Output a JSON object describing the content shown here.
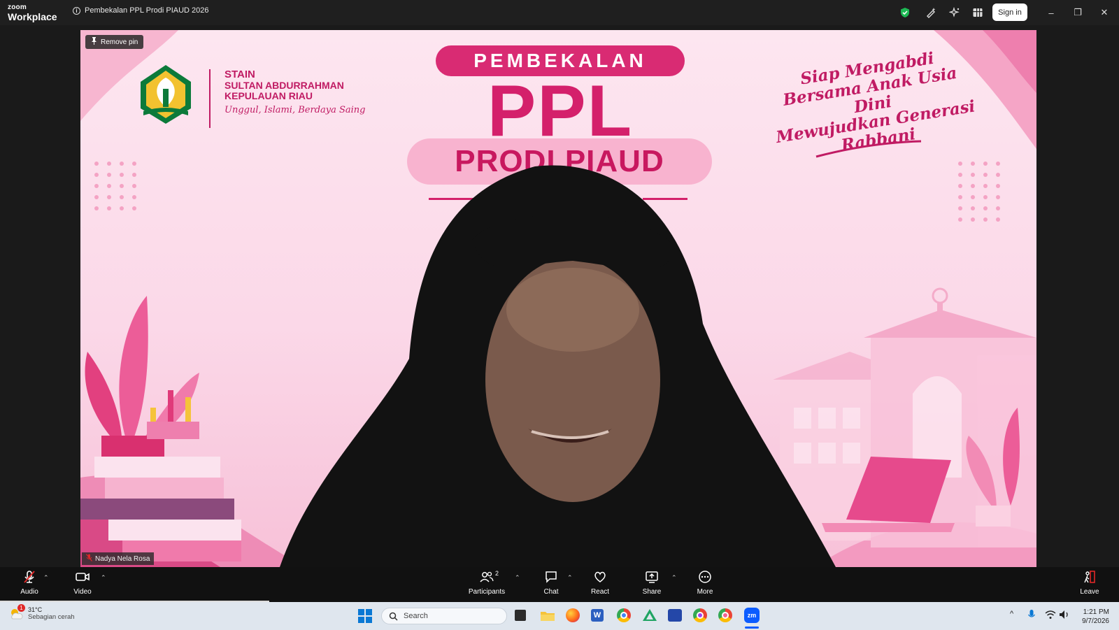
{
  "app": {
    "logo_top": "zoom",
    "logo_bottom": "Workplace"
  },
  "meeting": {
    "title": "Pembekalan PPL Prodi PIAUD 2026"
  },
  "titlebar": {
    "sign_in": "Sign in",
    "icons": [
      "shield-check-icon",
      "pen-sparkle-icon",
      "ai-sparkle-icon",
      "apps-grid-icon"
    ],
    "window_controls": {
      "minimize": "–",
      "restore": "❐",
      "close": "✕"
    }
  },
  "video": {
    "remove_pin": "Remove pin",
    "participant_name": "Nadya Nela Rosa",
    "slide": {
      "institution_line1": "STAIN",
      "institution_line2": "SULTAN ABDURRAHMAN",
      "institution_line3": "KEPULAUAN RIAU",
      "tagline": "Unggul, Islami, Berdaya Saing",
      "banner": "PEMBEKALAN",
      "ppl": "PPL",
      "prodi": "PRODI PIAUD",
      "slogan": [
        "Siap Mengabdi",
        "Bersama Anak Usia Dini",
        "Mewujudkan Generasi",
        "Rabbani"
      ]
    }
  },
  "toolbar": {
    "audio": "Audio",
    "video": "Video",
    "participants": "Participants",
    "participants_count": "2",
    "chat": "Chat",
    "react": "React",
    "share": "Share",
    "more": "More",
    "leave": "Leave"
  },
  "taskbar": {
    "weather_temp": "31°C",
    "weather_desc": "Sebagian cerah",
    "weather_badge": "1",
    "search_placeholder": "Search",
    "time": "1:21 PM",
    "date": "9/7/2026"
  },
  "colors": {
    "accent_pink": "#d4206b",
    "zoom_blue": "#0b5cff",
    "leave_red": "#e02828"
  }
}
